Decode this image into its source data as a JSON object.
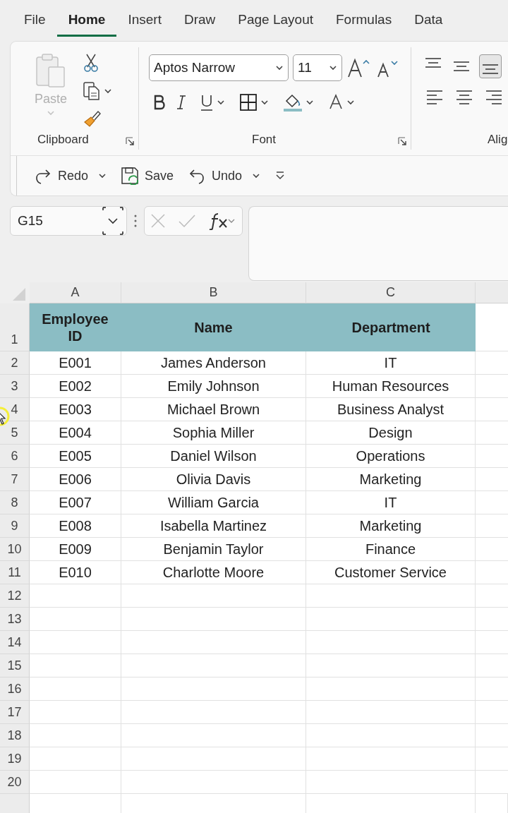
{
  "tabs": [
    {
      "label": "File",
      "selected": false
    },
    {
      "label": "Home",
      "selected": true
    },
    {
      "label": "Insert",
      "selected": false
    },
    {
      "label": "Draw",
      "selected": false
    },
    {
      "label": "Page Layout",
      "selected": false
    },
    {
      "label": "Formulas",
      "selected": false
    },
    {
      "label": "Data",
      "selected": false
    }
  ],
  "ribbon": {
    "clipboard": {
      "label": "Clipboard",
      "paste_label": "Paste",
      "paste_disabled": true
    },
    "font": {
      "label": "Font",
      "font_name": "Aptos Narrow",
      "font_size": "11"
    },
    "alignment": {
      "label": "Alig",
      "vertical": [
        {
          "kind": "top",
          "selected": false
        },
        {
          "kind": "middle",
          "selected": false
        },
        {
          "kind": "bottom",
          "selected": true
        }
      ]
    }
  },
  "quick_access": [
    {
      "kind": "redo",
      "label": "Redo",
      "has_menu": true
    },
    {
      "kind": "save",
      "label": "Save",
      "has_menu": false
    },
    {
      "kind": "undo",
      "label": "Undo",
      "has_menu": true
    }
  ],
  "formula_bar": {
    "name_box": "G15"
  },
  "sheet": {
    "columns": [
      "A",
      "B",
      "C"
    ],
    "rows": [
      {
        "number": "1",
        "kind": "header",
        "cells": [
          "Employee ID",
          "Name",
          "Department"
        ]
      },
      {
        "number": "2",
        "kind": "data",
        "cells": [
          "E001",
          "James Anderson",
          "IT"
        ]
      },
      {
        "number": "3",
        "kind": "data",
        "cells": [
          "E002",
          "Emily Johnson",
          "Human Resources"
        ]
      },
      {
        "number": "4",
        "kind": "data",
        "cells": [
          "E003",
          "Michael Brown",
          "Business Analyst"
        ]
      },
      {
        "number": "5",
        "kind": "data",
        "cells": [
          "E004",
          "Sophia Miller",
          "Design"
        ]
      },
      {
        "number": "6",
        "kind": "data",
        "cells": [
          "E005",
          "Daniel Wilson",
          "Operations"
        ]
      },
      {
        "number": "7",
        "kind": "data",
        "cells": [
          "E006",
          "Olivia Davis",
          "Marketing"
        ]
      },
      {
        "number": "8",
        "kind": "data",
        "cells": [
          "E007",
          "William Garcia",
          "IT"
        ]
      },
      {
        "number": "9",
        "kind": "data",
        "cells": [
          "E008",
          "Isabella Martinez",
          "Marketing"
        ]
      },
      {
        "number": "10",
        "kind": "data",
        "cells": [
          "E009",
          "Benjamin Taylor",
          "Finance"
        ]
      },
      {
        "number": "11",
        "kind": "data",
        "cells": [
          "E010",
          "Charlotte Moore",
          "Customer Service"
        ]
      },
      {
        "number": "12",
        "kind": "empty",
        "cells": []
      },
      {
        "number": "13",
        "kind": "empty",
        "cells": []
      },
      {
        "number": "14",
        "kind": "empty",
        "cells": []
      },
      {
        "number": "15",
        "kind": "empty",
        "cells": []
      },
      {
        "number": "16",
        "kind": "empty",
        "cells": []
      },
      {
        "number": "17",
        "kind": "empty",
        "cells": []
      },
      {
        "number": "18",
        "kind": "empty",
        "cells": []
      },
      {
        "number": "19",
        "kind": "empty",
        "cells": []
      },
      {
        "number": "20",
        "kind": "empty",
        "cells": []
      }
    ]
  }
}
